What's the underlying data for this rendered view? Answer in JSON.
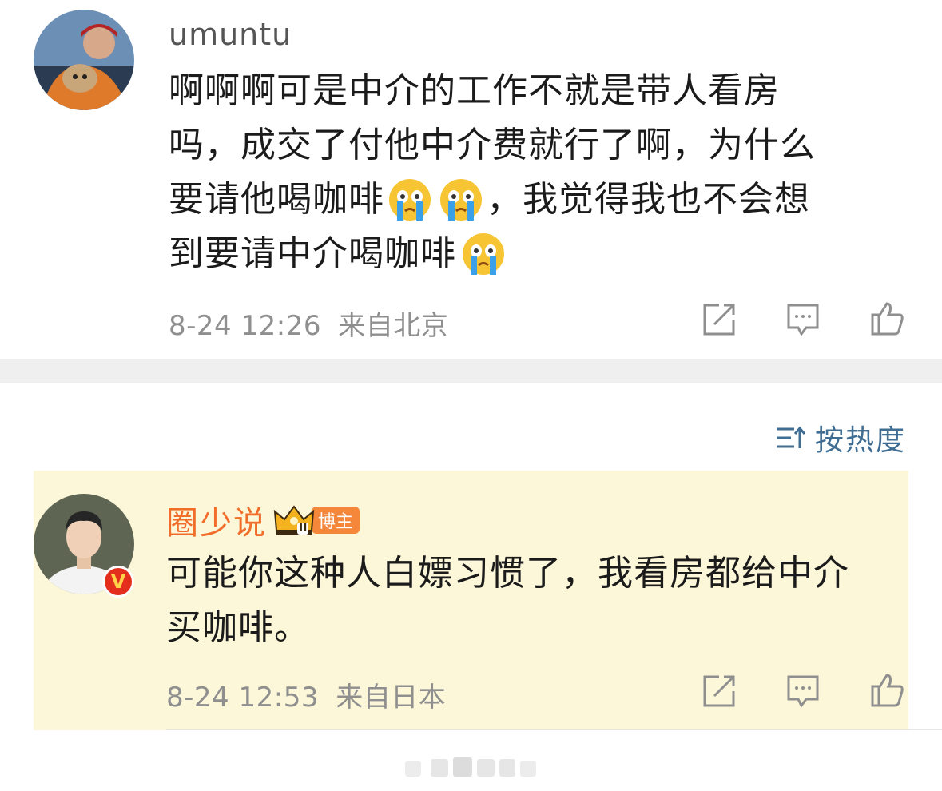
{
  "comments": [
    {
      "username": "umuntu",
      "lines": [
        "啊啊啊可是中介的工作不就是带人看房",
        "吗，成交了付他中介费就行了啊，为什么",
        "要请他喝咖啡",
        "，我觉得我也不会想",
        "到要请中介喝咖啡"
      ],
      "emoji": "crying-face-emoji",
      "date": "8-24 12:26",
      "location": "来自北京"
    },
    {
      "username": "圈少说",
      "badge": "博主",
      "lines": [
        "可能你这种人白嫖习惯了，我看房都给中介",
        "买咖啡。"
      ],
      "date": "8-24 12:53",
      "location": "来自日本",
      "verified": "V",
      "crown_level": "II"
    }
  ],
  "sort": {
    "label": "按热度"
  },
  "colors": {
    "accent_link": "#3f6d93",
    "highlight_bg": "#fdf7d9",
    "username_orange": "#f06d2a",
    "badge": "#f5873a"
  }
}
